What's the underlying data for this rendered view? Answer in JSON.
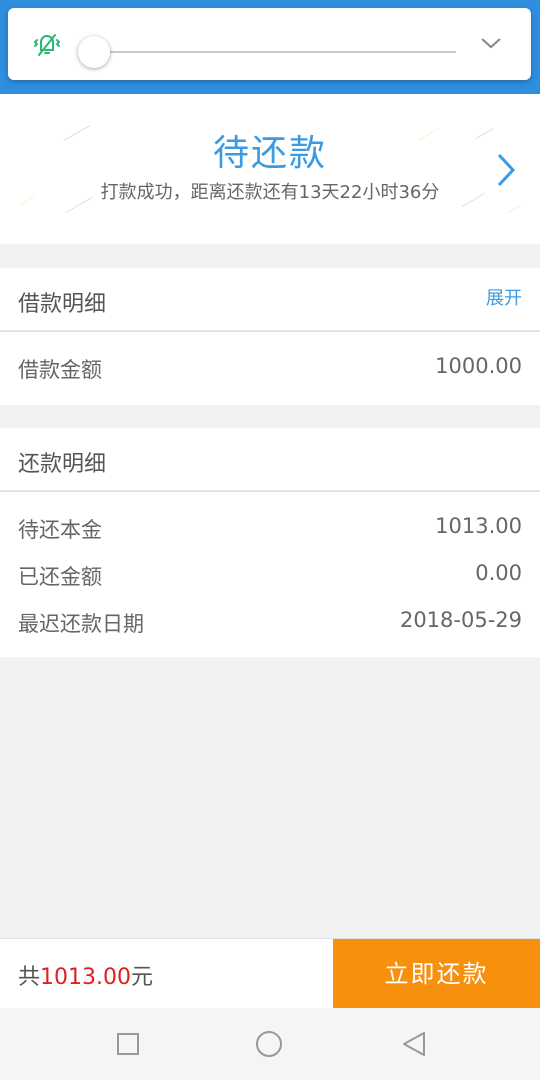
{
  "hero": {
    "title": "待还款",
    "subtitle": "打款成功，距离还款还有13天22小时36分"
  },
  "loan_details": {
    "title": "借款明细",
    "expand_label": "展开",
    "rows": [
      {
        "label": "借款金额",
        "value": "1000.00"
      }
    ]
  },
  "repayment_details": {
    "title": "还款明细",
    "rows": [
      {
        "label": "待还本金",
        "value": "1013.00"
      },
      {
        "label": "已还金额",
        "value": "0.00"
      },
      {
        "label": "最迟还款日期",
        "value": "2018-05-29"
      }
    ]
  },
  "footer": {
    "total_prefix": "共",
    "total_amount": "1013.00",
    "total_suffix": "元",
    "pay_button_label": "立即还款"
  },
  "volume": {
    "level": 0,
    "icon": "vibrate-bell-icon"
  },
  "colors": {
    "accent_blue": "#3a9be3",
    "app_bar_blue": "#2f8ee0",
    "pay_orange": "#f7900c",
    "amount_red": "#e02020",
    "vibrate_green": "#2bb673"
  },
  "nav": {
    "icons": [
      "recent-apps-icon",
      "home-icon",
      "back-icon"
    ]
  }
}
